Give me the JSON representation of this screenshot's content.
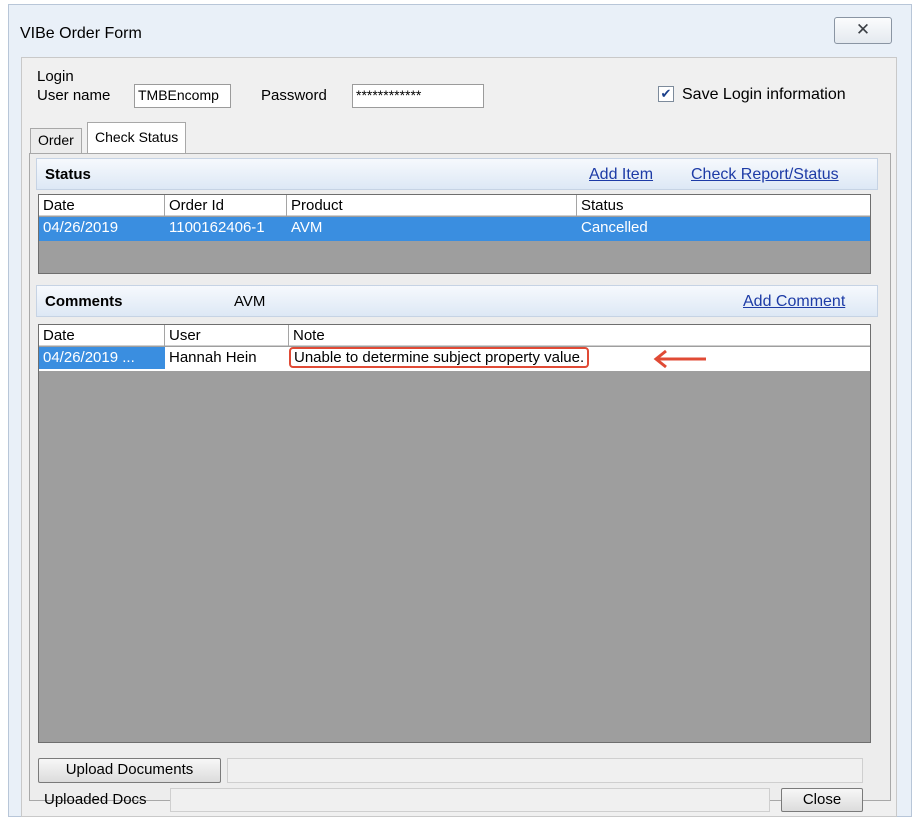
{
  "window": {
    "title": "VIBe Order Form",
    "close_glyph": "✕"
  },
  "login": {
    "group_label": "Login",
    "username_label": "User name",
    "username_value": "TMBEncomp",
    "password_label": "Password",
    "password_value": "************",
    "save_checked": true,
    "save_label": "Save Login information"
  },
  "tabs": [
    {
      "label": "Order",
      "active": false
    },
    {
      "label": "Check Status",
      "active": true
    }
  ],
  "status": {
    "title": "Status",
    "add_item_link": "Add Item",
    "check_report_link": "Check Report/Status",
    "columns": [
      "Date",
      "Order Id",
      "Product",
      "Status"
    ],
    "rows": [
      {
        "date": "04/26/2019",
        "order_id": "1100162406-1",
        "product": "AVM",
        "status": "Cancelled"
      }
    ]
  },
  "comments": {
    "title": "Comments",
    "product_label": "AVM",
    "add_comment_link": "Add Comment",
    "columns": [
      "Date",
      "User",
      "Note"
    ],
    "rows": [
      {
        "date": "04/26/2019 ...",
        "user": "Hannah Hein",
        "note": "Unable to determine subject property value."
      }
    ]
  },
  "footer": {
    "upload_button": "Upload Documents",
    "uploaded_docs_label": "Uploaded Docs",
    "close_button": "Close"
  },
  "colors": {
    "selection": "#3a8ee0",
    "highlight_annotation": "#e04a35",
    "link": "#1d3ba6"
  },
  "icons": {
    "annotation": "arrow-left-icon",
    "checkbox": "checkmark-icon"
  }
}
